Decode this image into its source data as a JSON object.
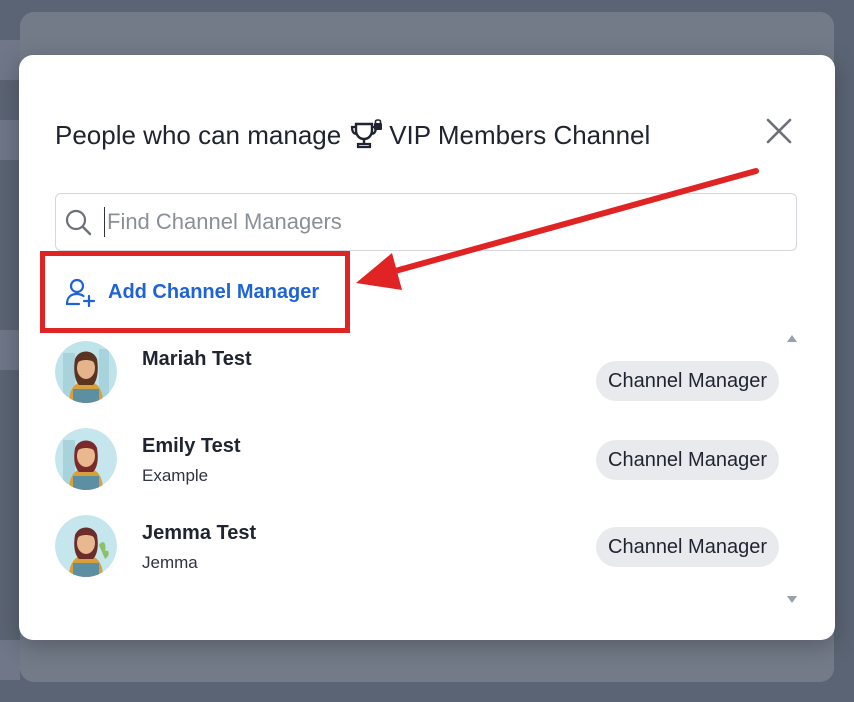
{
  "modal": {
    "title_prefix": "People who can manage",
    "title_channel": "VIP Members Channel",
    "title_icon": "trophy-lock-icon",
    "close_icon": "close-icon"
  },
  "search": {
    "placeholder": "Find Channel Managers",
    "value": "",
    "icon": "search-icon"
  },
  "add_manager": {
    "label": "Add Channel Manager",
    "icon": "user-plus-icon"
  },
  "managers": [
    {
      "name": "Mariah Test",
      "subtitle": "",
      "role": "Channel Manager",
      "avatar": "avatar-icon"
    },
    {
      "name": "Emily Test",
      "subtitle": "Example",
      "role": "Channel Manager",
      "avatar": "avatar-icon"
    },
    {
      "name": "Jemma Test",
      "subtitle": "Jemma",
      "role": "Channel Manager",
      "avatar": "avatar-icon"
    }
  ],
  "colors": {
    "accent": "#1f63d8",
    "highlight": "#e02323",
    "badge_bg": "#e8eaee"
  }
}
